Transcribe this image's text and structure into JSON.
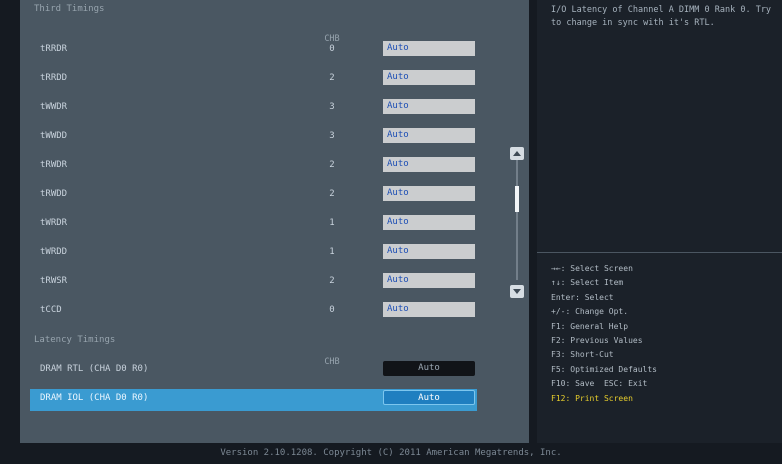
{
  "sections": {
    "third_timings": "Third Timings",
    "latency_timings": "Latency Timings",
    "chb_header": "CHB"
  },
  "third_timing_rows": [
    {
      "label": "tRRDR",
      "chb": "0",
      "value": "Auto"
    },
    {
      "label": "tRRDD",
      "chb": "2",
      "value": "Auto"
    },
    {
      "label": "tWWDR",
      "chb": "3",
      "value": "Auto"
    },
    {
      "label": "tWWDD",
      "chb": "3",
      "value": "Auto"
    },
    {
      "label": "tRWDR",
      "chb": "2",
      "value": "Auto"
    },
    {
      "label": "tRWDD",
      "chb": "2",
      "value": "Auto"
    },
    {
      "label": "tWRDR",
      "chb": "1",
      "value": "Auto"
    },
    {
      "label": "tWRDD",
      "chb": "1",
      "value": "Auto"
    },
    {
      "label": "tRWSR",
      "chb": "2",
      "value": "Auto"
    },
    {
      "label": "tCCD",
      "chb": "0",
      "value": "Auto"
    }
  ],
  "latency_rows": [
    {
      "label": "DRAM RTL (CHA D0 R0)",
      "value": "Auto"
    },
    {
      "label": "DRAM IOL (CHA D0 R0)",
      "value": "Auto"
    }
  ],
  "help": {
    "description": "I/O Latency of Channel A DIMM 0 Rank 0. Try to change in sync with it's RTL."
  },
  "keys": [
    "→←: Select Screen",
    "↑↓: Select Item",
    "Enter: Select",
    "+/-: Change Opt.",
    "F1: General Help",
    "F2: Previous Values",
    "F3: Short-Cut",
    "F5: Optimized Defaults",
    "F10: Save  ESC: Exit",
    "F12: Print Screen"
  ],
  "footer": "Version 2.10.1208. Copyright (C) 2011 American Megatrends, Inc.",
  "colors": {
    "panel_bg": "#4a5762",
    "help_bg": "#1b2129",
    "selected_row": "#3a9bd1",
    "value_text": "#1e4fb5",
    "highlight_key": "#e6cd2c"
  }
}
